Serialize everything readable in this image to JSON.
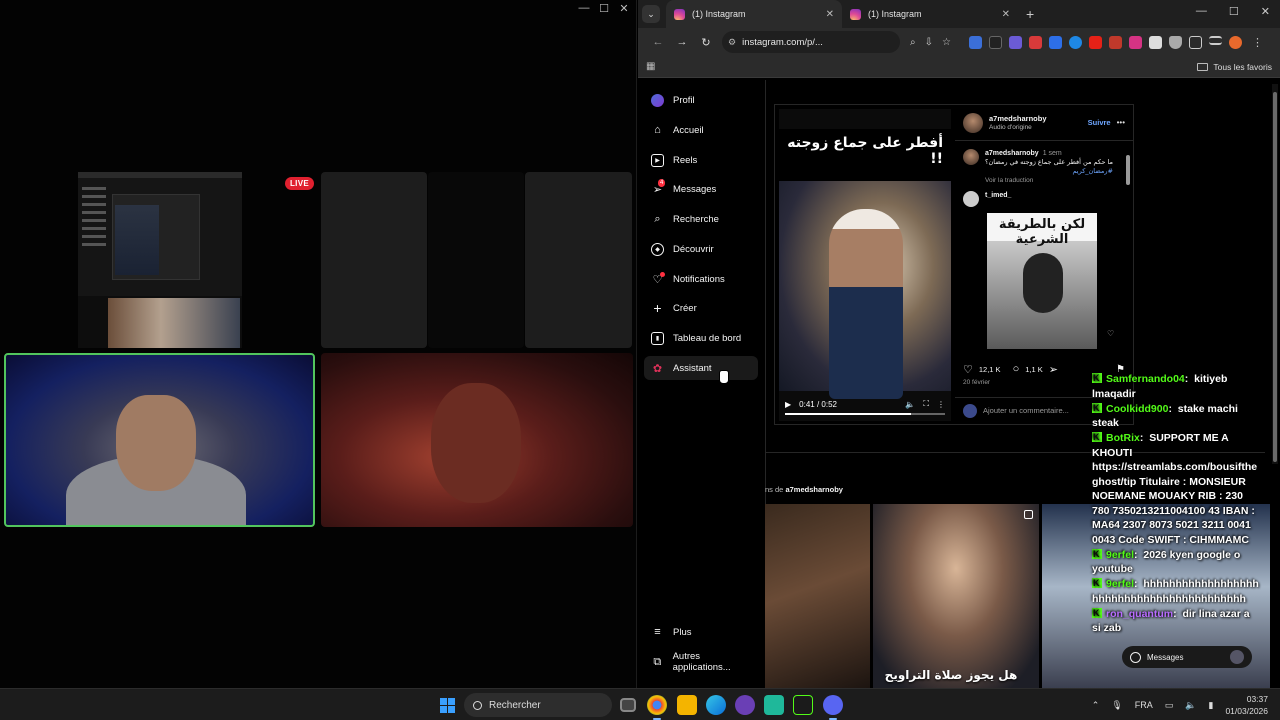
{
  "call_window": {
    "live_badge": "LIVE"
  },
  "browser": {
    "tabs": [
      {
        "label": "(1) Instagram",
        "active": true
      },
      {
        "label": "(1) Instagram",
        "active": false
      }
    ],
    "url": "instagram.com/p/...",
    "bookmarks_all": "Tous les favoris"
  },
  "instagram": {
    "nav": [
      {
        "key": "profile",
        "label": "Profil",
        "icon": "profile-icon"
      },
      {
        "key": "home",
        "label": "Accueil",
        "icon": "home-icon"
      },
      {
        "key": "reels",
        "label": "Reels",
        "icon": "reels-icon"
      },
      {
        "key": "messages",
        "label": "Messages",
        "icon": "messages-icon",
        "badge": "4"
      },
      {
        "key": "search",
        "label": "Recherche",
        "icon": "search-icon"
      },
      {
        "key": "explore",
        "label": "Découvrir",
        "icon": "compass-icon"
      },
      {
        "key": "notifications",
        "label": "Notifications",
        "icon": "heart-icon"
      },
      {
        "key": "create",
        "label": "Créer",
        "icon": "plus-icon"
      },
      {
        "key": "dashboard",
        "label": "Tableau de bord",
        "icon": "dashboard-icon"
      },
      {
        "key": "assistant",
        "label": "Assistant",
        "icon": "assistant-icon"
      },
      {
        "key": "more",
        "label": "Plus",
        "icon": "menu-icon"
      },
      {
        "key": "apps",
        "label": "Autres applications...",
        "icon": "apps-icon"
      }
    ],
    "post": {
      "video_title": "أفطر على جماع زوجته !!",
      "time_current": "0:41",
      "time_total": "0:52",
      "time_display": "0:41 / 0:52",
      "progress": 0.79,
      "author": "a7medsharnoby",
      "audio": "Audio d'origine",
      "follow": "Suivre",
      "caption_user": "a7medsharnoby",
      "caption_time": "1 sem",
      "caption_text": "ما حكم من أفطر على جماع زوجته في رمضان؟",
      "caption_tag": "#رمضان_كريم",
      "see_translation": "Voir la traduction",
      "comment_user": "t_imed_",
      "comment_image_text": "لكن بالطريقة الشرعية",
      "likes": "12,1 K",
      "comments_count": "1,1 K",
      "date": "20 février",
      "add_comment_placeholder": "Ajouter un commentaire..."
    },
    "more_from_prefix": "ns de",
    "more_from_user": "a7medsharnoby",
    "thumb_caption": "هل يجوز صلاة التراويح",
    "messages_pill": "Messages"
  },
  "chat": [
    {
      "user": "Samfernando04",
      "text": "kitiyeb lmaqadir",
      "color": "green"
    },
    {
      "user": "Coolkidd900",
      "text": "stake machi steak",
      "color": "green"
    },
    {
      "user": "BotRix",
      "text": "SUPPORT ME A KHOUTI https://streamlabs.com/bousiftheghost/tip Titulaire : MONSIEUR NOEMANE MOUAKY RIB : 230 780 7350213211004100 43 IBAN : MA64 2307 8073 5021 3211 0041 0043 Code SWIFT : CIHMMAMC",
      "color": "green"
    },
    {
      "user": "9erfel",
      "text": "2026 kyen google o youtube",
      "color": "green"
    },
    {
      "user": "9erfel",
      "text": "hhhhhhhhhhhhhhhhhhhhhhhhhhhhhhhhhhhhhhhhhh",
      "color": "green"
    },
    {
      "user": "ron_quantum",
      "text": "dir lina azar a si zab",
      "color": "purple"
    }
  ],
  "taskbar": {
    "search_label": "Rechercher",
    "lang": "FRA",
    "time": "03:37",
    "date": "01/03/2026"
  }
}
